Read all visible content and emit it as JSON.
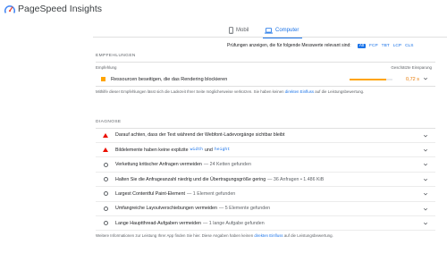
{
  "header": {
    "app_title": "PageSpeed Insights"
  },
  "tabs": [
    {
      "label": "Mobil"
    },
    {
      "label": "Computer"
    }
  ],
  "filter": {
    "label": "Prüfungen anzeigen, die für folgende Messwerte relevant sind:",
    "metrics": [
      "All",
      "FCP",
      "TBT",
      "LCP",
      "CLS"
    ],
    "active": "All"
  },
  "opportunities": {
    "section_title": "EMPFEHLUNGEN",
    "col_left": "Empfehlung",
    "col_right": "Geschätzte Einsparung",
    "items": [
      {
        "title": "Ressourcen beseitigen, die das Rendering blockieren",
        "savings": "0,72 s",
        "savings_fraction": 0.86,
        "status_color": "#ffa400"
      }
    ],
    "help_prefix": "Mithilfe dieser Empfehlungen lässt sich die Ladezeit Ihrer Seite möglicherweise verkürzen. Sie haben keinen ",
    "help_link": "direkten Einfluss",
    "help_suffix": " auf die Leistungsbewertung."
  },
  "diagnostics": {
    "section_title": "DIAGNOSE",
    "items": [
      {
        "icon": "warning-triangle",
        "title": "Darauf achten, dass der Text während der Webfont-Ladevorgänge sichtbar bleibt",
        "detail": ""
      },
      {
        "icon": "warning-triangle",
        "title": "Bildelemente haben keine explizite",
        "code1": "width",
        "mid": "und",
        "code2": "height",
        "detail": ""
      },
      {
        "icon": "info-circle",
        "title": "Verkettung kritischer Anfragen vermeiden",
        "detail": "— 24 Ketten gefunden"
      },
      {
        "icon": "info-circle",
        "title": "Halten Sie die Anfrageanzahl niedrig und die Übertragungsgröße gering",
        "detail": "— 36 Anfragen • 1.486 KiB"
      },
      {
        "icon": "info-circle",
        "title": "Largest Contentful Paint-Element",
        "detail": "— 1 Element gefunden"
      },
      {
        "icon": "info-circle",
        "title": "Umfangreiche Layoutverschiebungen vermeiden",
        "detail": "— 5 Elemente gefunden"
      },
      {
        "icon": "info-circle",
        "title": "Lange Hauptthread-Aufgaben vermeiden",
        "detail": "— 1 lange Aufgabe gefunden"
      }
    ],
    "help_prefix": "Weitere Informationen zur Leistung Ihrer App finden Sie hier. Diese Angaben haben keinen ",
    "help_link": "direkten Einfluss",
    "help_suffix": " auf die Leistungsbewertung."
  },
  "colors": {
    "accent": "#1a73e8",
    "warning": "#ffa400",
    "fail": "#eb0f00"
  }
}
